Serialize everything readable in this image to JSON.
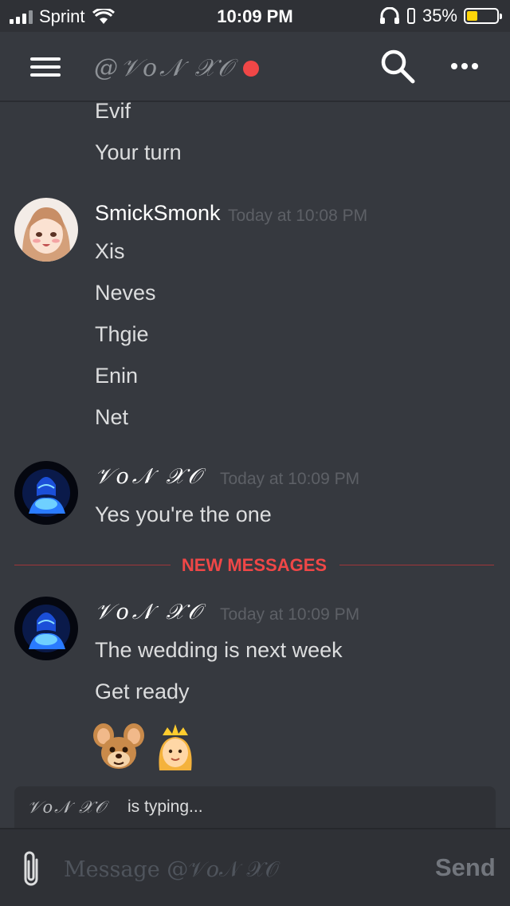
{
  "status_bar": {
    "carrier": "Sprint",
    "time": "10:09 PM",
    "battery": "35%",
    "battery_level": 0.35
  },
  "header": {
    "channel_name": "@𝒱𝑜𝒩 𝒳𝒪",
    "status_color": "#f04747",
    "icons": [
      "hamburger-menu-icon",
      "search-icon",
      "more-options-icon"
    ]
  },
  "messages": {
    "continued": [
      "Evif",
      "Your turn"
    ],
    "groups": [
      {
        "author": "SmickSmonk",
        "timestamp": "Today at 10:08 PM",
        "lines": [
          "Xis",
          "Neves",
          "Thgie",
          "Enin",
          "Net"
        ]
      },
      {
        "author": "𝒱𝑜𝒩 𝒳𝒪",
        "timestamp": "Today at 10:09 PM",
        "lines": [
          "Yes you're the one"
        ]
      },
      {
        "author": "𝒱𝑜𝒩 𝒳𝒪",
        "timestamp": "Today at 10:09 PM",
        "lines": [
          "The wedding is next week",
          "Get ready"
        ],
        "emoji": [
          "mouse-face-emoji",
          "princess-emoji"
        ]
      }
    ]
  },
  "new_messages_divider": "NEW MESSAGES",
  "typing_indicator": {
    "who": "𝒱𝑜𝒩 𝒳𝒪",
    "text": "is typing..."
  },
  "composer": {
    "placeholder": "Message @𝒱𝑜𝒩 𝒳𝒪",
    "send_label": "Send"
  },
  "colors": {
    "background": "#36393f",
    "danger": "#f04747"
  }
}
